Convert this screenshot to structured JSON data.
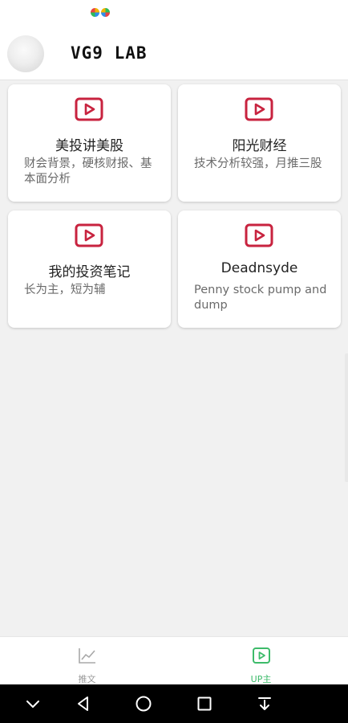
{
  "header": {
    "title": "VG9 LAB"
  },
  "colors": {
    "accent_red": "#c8233f",
    "tab_active": "#3dbb6a",
    "tab_inactive": "#9a9a9a"
  },
  "cards": [
    {
      "title": "美投讲美股",
      "description": "财会背景，硬核财报、基本面分析",
      "icon": "play-icon"
    },
    {
      "title": "阳光财经",
      "description": "技术分析较强，月推三股",
      "icon": "play-icon"
    },
    {
      "title": "我的投资笔记",
      "description": "长为主，短为辅",
      "icon": "play-icon"
    },
    {
      "title": "Deadnsyde",
      "description": "Penny stock pump and dump",
      "icon": "play-icon"
    }
  ],
  "tabs": [
    {
      "label": "推文",
      "icon": "chart-line-icon",
      "active": false
    },
    {
      "label": "UP主",
      "icon": "play-icon",
      "active": true
    }
  ],
  "system_nav": [
    "collapse-icon",
    "back-icon",
    "home-icon",
    "recents-icon",
    "notification-pull-icon"
  ]
}
